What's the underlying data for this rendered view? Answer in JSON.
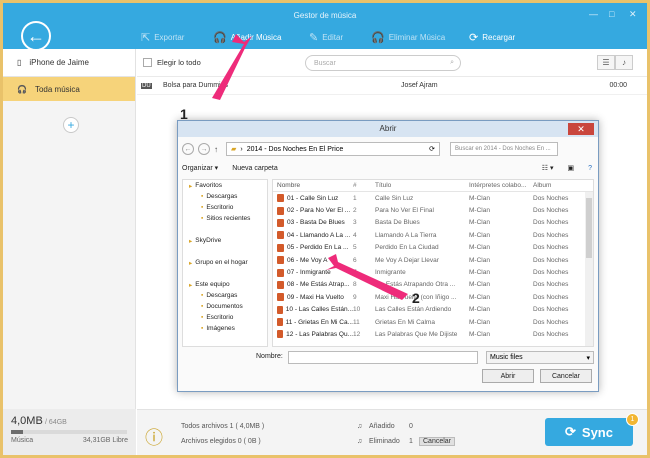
{
  "window": {
    "title": "Gestor de música",
    "controls": [
      "—",
      "□",
      "✕"
    ]
  },
  "toolbar": {
    "items": [
      {
        "label": "Exportar",
        "icon": "export-icon",
        "active": false
      },
      {
        "label": "Añadir Música",
        "icon": "headphones-add-icon",
        "active": true
      },
      {
        "label": "Editar",
        "icon": "edit-icon",
        "active": false
      },
      {
        "label": "Eliminar Música",
        "icon": "headphones-remove-icon",
        "active": false
      },
      {
        "label": "Recargar",
        "icon": "reload-icon",
        "active": true
      }
    ]
  },
  "sidebar": {
    "device": "iPhone de Jaime",
    "all_music": "Toda música",
    "storage": {
      "used": "4,0MB",
      "total": "/ 64GB",
      "label": "Música",
      "free": "34,31GB Libre",
      "fill_fraction": 0.02
    }
  },
  "main": {
    "select_all": "Elegir lo todo",
    "search_placeholder": "Buscar",
    "songs": [
      {
        "name": "Bolsa para Dummies",
        "artist": "Josef Ajram",
        "time": "00:00"
      }
    ]
  },
  "bottom": {
    "all_files": "Todos archivos 1 ( 4,0MB )",
    "selected_files": "Archivos elegidos 0 ( 0B )",
    "added_label": "Añadido",
    "added_count": "0",
    "removed_label": "Eliminado",
    "removed_count": "1",
    "cancel": "Cancelar",
    "sync": "Sync",
    "sync_badge": "1"
  },
  "dialog": {
    "title": "Abrir",
    "path": "2014 - Dos Noches En El Price",
    "search_placeholder": "Buscar en 2014 - Dos Noches En ...",
    "organize": "Organizar ▾",
    "new_folder": "Nueva carpeta",
    "tree": [
      {
        "label": "Favoritos",
        "indent": 0
      },
      {
        "label": "Descargas",
        "indent": 1
      },
      {
        "label": "Escritorio",
        "indent": 1
      },
      {
        "label": "Sitios recientes",
        "indent": 1
      },
      {
        "label": "",
        "indent": 0
      },
      {
        "label": "SkyDrive",
        "indent": 0
      },
      {
        "label": "",
        "indent": 0
      },
      {
        "label": "Grupo en el hogar",
        "indent": 0
      },
      {
        "label": "",
        "indent": 0
      },
      {
        "label": "Este equipo",
        "indent": 0
      },
      {
        "label": "Descargas",
        "indent": 1
      },
      {
        "label": "Documentos",
        "indent": 1
      },
      {
        "label": "Escritorio",
        "indent": 1
      },
      {
        "label": "Imágenes",
        "indent": 1
      }
    ],
    "columns": [
      "Nombre",
      "#",
      "Título",
      "Intérpretes colabo...",
      "Álbum"
    ],
    "files": [
      [
        "01 - Calle Sin Luz",
        "1",
        "Calle Sin Luz",
        "M-Clan",
        "Dos Noches"
      ],
      [
        "02 - Para No Ver El ...",
        "2",
        "Para No Ver El Final",
        "M-Clan",
        "Dos Noches"
      ],
      [
        "03 - Basta De Blues",
        "3",
        "Basta De Blues",
        "M-Clan",
        "Dos Noches"
      ],
      [
        "04 - Llamando A La ...",
        "4",
        "Llamando A La Tierra",
        "M-Clan",
        "Dos Noches"
      ],
      [
        "05 - Perdido En La ...",
        "5",
        "Perdido En La Ciudad",
        "M-Clan",
        "Dos Noches"
      ],
      [
        "06 - Me Voy A",
        "6",
        "Me Voy A Dejar Llevar",
        "M-Clan",
        "Dos Noches"
      ],
      [
        "07 - Inmigrante",
        "7",
        "Inmigrante",
        "M-Clan",
        "Dos Noches"
      ],
      [
        "08 - Me Estás Atrap...",
        "8",
        "Me Estás Atrapando Otra ...",
        "M-Clan",
        "Dos Noches"
      ],
      [
        "09 - Maxi Ha Vuelto",
        "9",
        "Maxi Ha Vuelto (con Íñigo ...",
        "M-Clan",
        "Dos Noches"
      ],
      [
        "10 - Las Calles Están...",
        "10",
        "Las Calles Están Ardiendo",
        "M-Clan",
        "Dos Noches"
      ],
      [
        "11 - Grietas En Mi Ca...",
        "11",
        "Grietas En Mi Calma",
        "M-Clan",
        "Dos Noches"
      ],
      [
        "12 - Las Palabras Qu...",
        "12",
        "Las Palabras Que Me Dijiste",
        "M-Clan",
        "Dos Noches"
      ]
    ],
    "name_label": "Nombre:",
    "file_type": "Music files",
    "open": "Abrir",
    "cancel": "Cancelar"
  },
  "annotations": {
    "one": "1",
    "two": "2",
    "arrow_color": "#ee2b7a"
  }
}
